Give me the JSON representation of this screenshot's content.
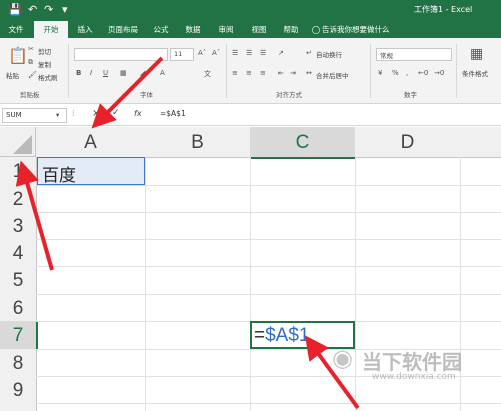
{
  "title_bar": {
    "title": "工作簿1 - Excel"
  },
  "tabs": [
    "文件",
    "开始",
    "插入",
    "页面布局",
    "公式",
    "数据",
    "审阅",
    "视图",
    "帮助"
  ],
  "tell_me": "告诉我你想要做什么",
  "ribbon": {
    "clipboard": {
      "paste": "粘贴",
      "cut": "剪切",
      "copy": "复制",
      "format_painter": "格式刷",
      "group": "剪贴板"
    },
    "font": {
      "size": "11",
      "group": "字体"
    },
    "alignment": {
      "wrap": "自动换行",
      "merge": "合并后居中",
      "group": "对齐方式"
    },
    "number": {
      "format": "常规",
      "percent": "%",
      "thousands": ",",
      "group": "数字"
    },
    "conditional": "条件格式"
  },
  "formula_bar": {
    "name_box": "SUM",
    "cancel": "×",
    "enter": "✓",
    "fx": "fx",
    "formula": "=$A$1"
  },
  "grid": {
    "columns": [
      "A",
      "B",
      "C",
      "D"
    ],
    "rows": [
      "1",
      "2",
      "3",
      "4",
      "5",
      "6",
      "7",
      "8",
      "9"
    ],
    "cells": {
      "A1": "百度",
      "C7": "=$A$1"
    }
  },
  "watermark": {
    "text": "当下软件园",
    "url": "www.downxia.com"
  },
  "colors": {
    "accent": "#217346",
    "reference": "#2e6bd0",
    "arrow": "#e8222a"
  }
}
